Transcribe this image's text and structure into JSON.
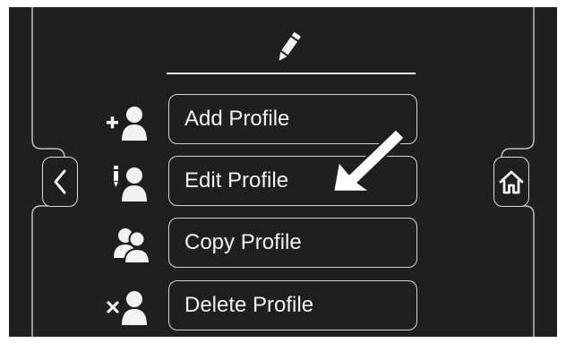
{
  "header": {
    "icon": "pencil-icon"
  },
  "navigation": {
    "back_icon": "chevron-left-icon",
    "home_icon": "home-icon"
  },
  "menu": {
    "items": [
      {
        "label": "Add Profile",
        "icon": "add-profile-icon"
      },
      {
        "label": "Edit Profile",
        "icon": "edit-profile-icon"
      },
      {
        "label": "Copy Profile",
        "icon": "copy-profile-icon"
      },
      {
        "label": "Delete Profile",
        "icon": "delete-profile-icon"
      }
    ]
  },
  "annotation": {
    "icon": "pointer-arrow-icon",
    "color": "#ffffff"
  },
  "colors": {
    "background": "#1f1f1f",
    "foreground": "#f2f2f2",
    "border": "#d4d4d4"
  }
}
